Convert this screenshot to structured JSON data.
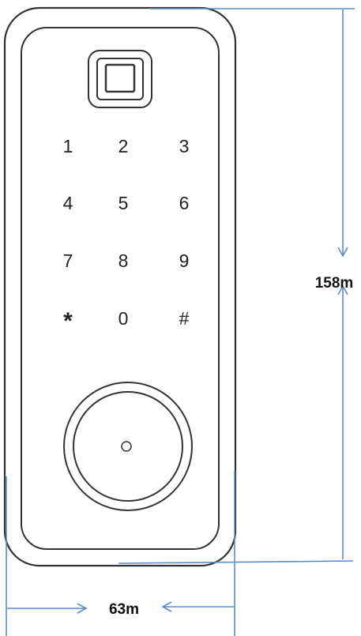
{
  "keypad": {
    "rows": [
      [
        "1",
        "2",
        "3"
      ],
      [
        "4",
        "5",
        "6"
      ],
      [
        "7",
        "8",
        "9"
      ],
      [
        "*",
        "0",
        "#"
      ]
    ]
  },
  "dimensions": {
    "height_label": "158m",
    "width_label": "63m"
  },
  "colors": {
    "outline": "#333333",
    "dimension_line": "#5b8cc8"
  }
}
